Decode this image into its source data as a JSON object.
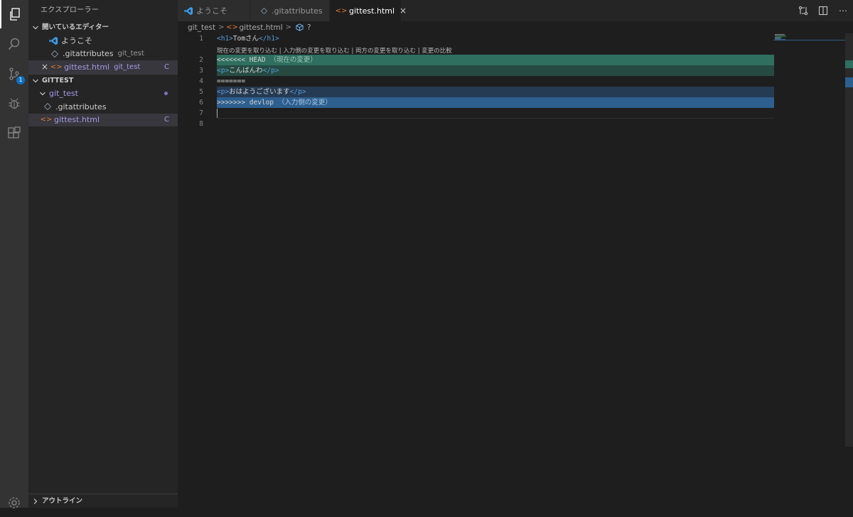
{
  "activity_bar": {
    "scm_badge": "1"
  },
  "sidebar": {
    "title": "エクスプローラー",
    "open_editors": {
      "header": "開いているエディター",
      "items": [
        {
          "name": "ようこそ",
          "sub": ""
        },
        {
          "name": ".gitattributes",
          "sub": "git_test"
        },
        {
          "name": "gittest.html",
          "sub": "git_test",
          "status": "C"
        }
      ]
    },
    "workspace": {
      "header": "GITTEST",
      "folder": "git_test",
      "files": [
        {
          "name": ".gitattributes",
          "status": ""
        },
        {
          "name": "gittest.html",
          "status": "C"
        }
      ]
    },
    "outline_header": "アウトライン"
  },
  "tabs": [
    {
      "label": "ようこそ"
    },
    {
      "label": ".gitattributes"
    },
    {
      "label": "gittest.html",
      "close": "×"
    }
  ],
  "breadcrumb": {
    "folder": "git_test",
    "file": "gittest.html",
    "symbol": "?"
  },
  "editor": {
    "codelens": "現在の変更を取り込む | 入力側の変更を取り込む | 両方の変更を取り込む | 変更の比較",
    "line_numbers": [
      "1",
      "2",
      "3",
      "4",
      "5",
      "6",
      "7",
      "8"
    ],
    "lines": {
      "l1": {
        "open": "<h1>",
        "text": "Tomさん",
        "close": "</h1>"
      },
      "l2": {
        "text": "<<<<<<< HEAD",
        "hint": "（現在の変更）"
      },
      "l3": {
        "open": "<p>",
        "text": "こんばんわ",
        "close": "</p>"
      },
      "l4": {
        "text": "======="
      },
      "l5": {
        "open": "<p>",
        "text": "おはようございます",
        "close": "</p>"
      },
      "l6": {
        "text": ">>>>>>> devlop",
        "hint": "（入力側の変更）"
      }
    }
  },
  "colors": {
    "current_header": "#2f6f5f",
    "current_body": "#264a42",
    "incoming_body": "#253a53",
    "incoming_header": "#2d5f8f",
    "accent": "#0e70c0"
  }
}
